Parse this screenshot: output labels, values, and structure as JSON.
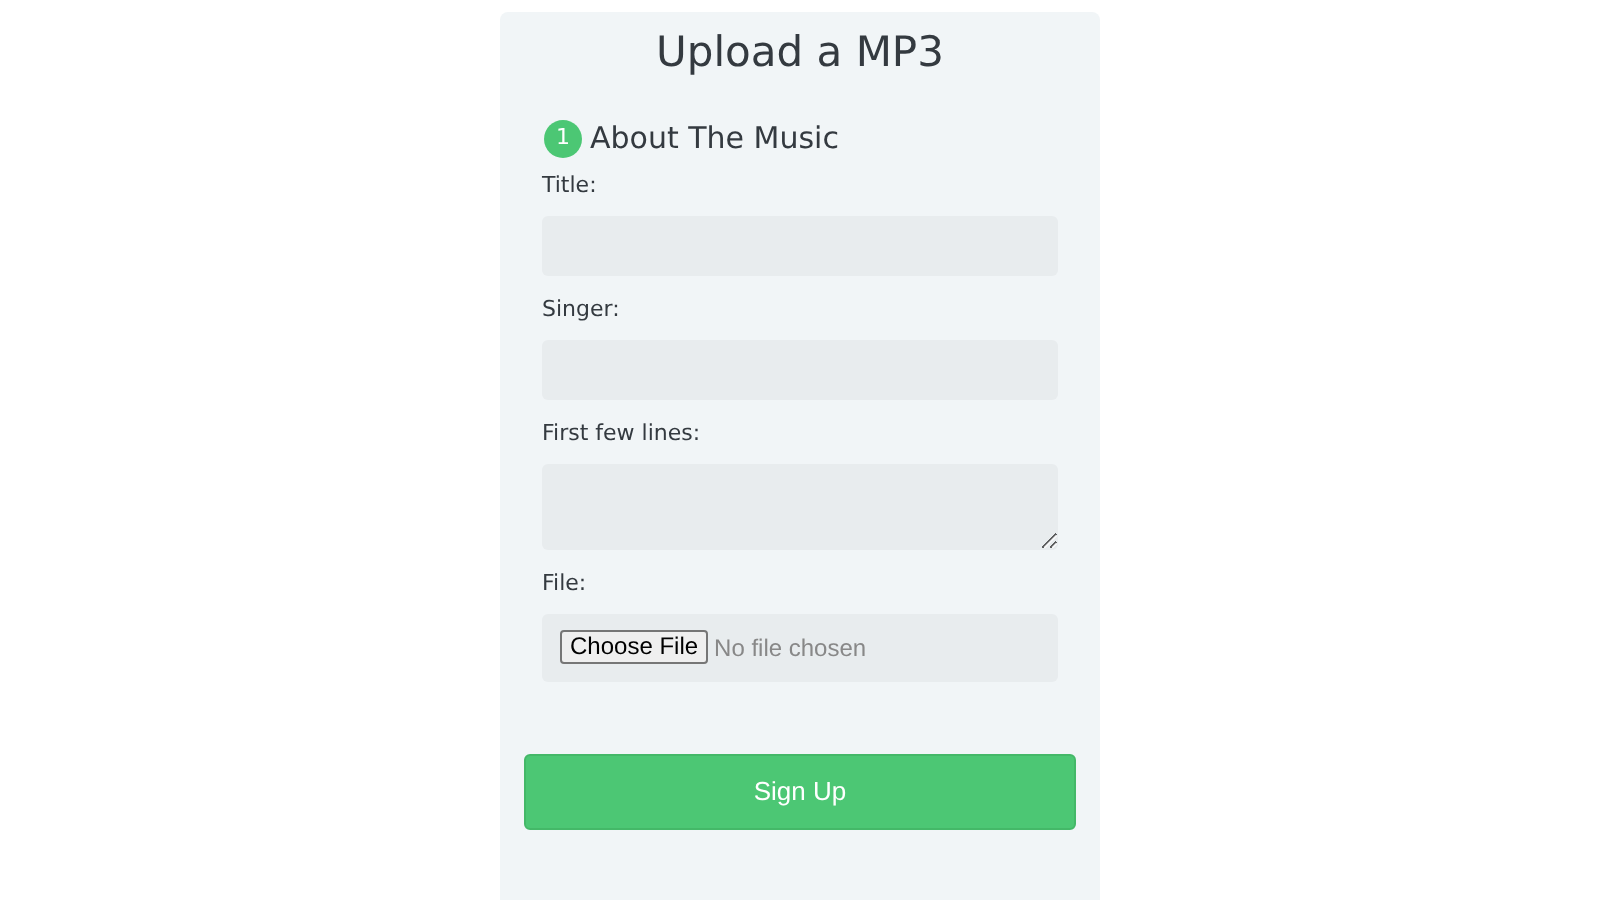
{
  "title": "Upload a MP3",
  "section": {
    "number": "1",
    "heading": "About The Music"
  },
  "fields": [
    {
      "kind": "text",
      "label": "Title:"
    },
    {
      "kind": "text",
      "label": "Singer:"
    },
    {
      "kind": "textarea",
      "label": "First few lines:"
    },
    {
      "kind": "file",
      "label": "File:",
      "button": "Choose File",
      "status": "No file chosen"
    }
  ],
  "submit": "Sign Up"
}
